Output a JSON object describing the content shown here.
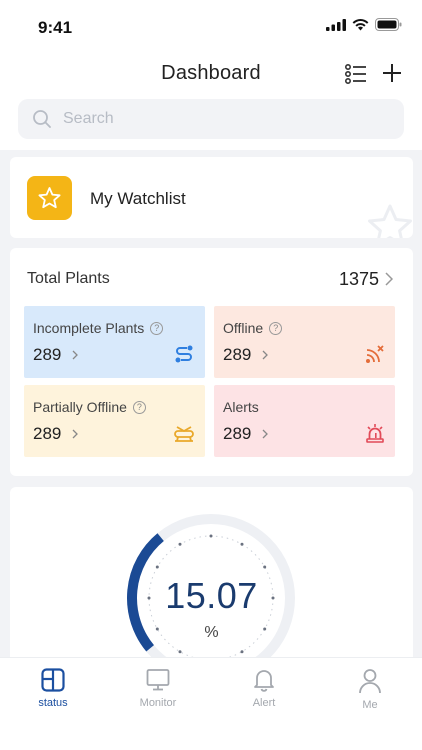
{
  "status_bar": {
    "time": "9:41"
  },
  "nav": {
    "title": "Dashboard"
  },
  "search": {
    "placeholder": "Search"
  },
  "watchlist": {
    "label": "My Watchlist"
  },
  "plants": {
    "title": "Total Plants",
    "total": "1375",
    "tiles": [
      {
        "label": "Incomplete Plants",
        "value": "289",
        "bg": "#d8e9fb",
        "icon": "connection-icon",
        "icon_color": "#2f7fe0"
      },
      {
        "label": "Offline",
        "value": "289",
        "bg": "#fde8e0",
        "icon": "signal-off-icon",
        "icon_color": "#e46d3a"
      },
      {
        "label": "Partially Offline",
        "value": "289",
        "bg": "#fef3dc",
        "icon": "partial-offline-icon",
        "icon_color": "#e9a82a"
      },
      {
        "label": "Alerts",
        "value": "289",
        "bg": "#fde3e5",
        "icon": "alarm-icon",
        "icon_color": "#e24a58"
      }
    ]
  },
  "gauge": {
    "value": "15.07",
    "unit": "%",
    "fill_fraction": 0.1507,
    "accent": "#1b4a94",
    "track": "#eef0f4"
  },
  "tabs": [
    {
      "label": "status",
      "icon": "status-icon",
      "active": true
    },
    {
      "label": "Monitor",
      "icon": "monitor-icon",
      "active": false
    },
    {
      "label": "Alert",
      "icon": "bell-icon",
      "active": false
    },
    {
      "label": "Me",
      "icon": "person-icon",
      "active": false
    }
  ],
  "colors": {
    "accent": "#1b4fa0",
    "star": "#f4b516"
  }
}
